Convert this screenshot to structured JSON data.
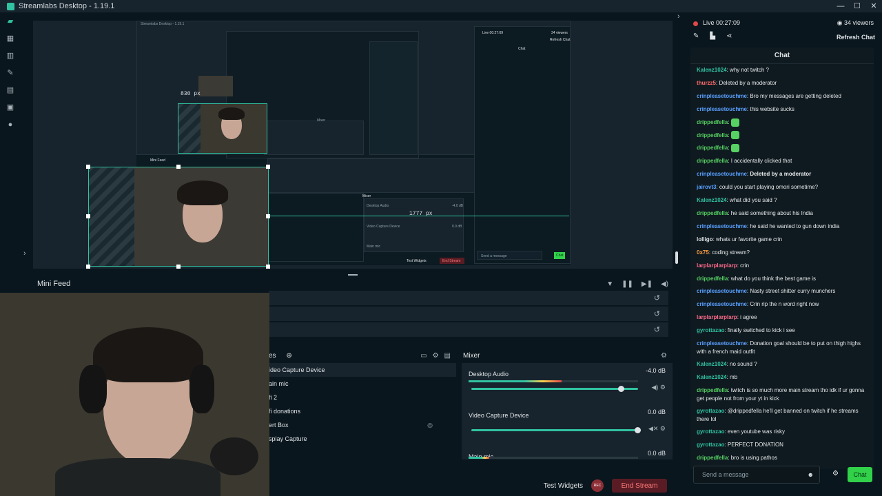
{
  "window": {
    "title": "Streamlabs Desktop - 1.19.1",
    "controls": [
      "—",
      "☐",
      "✕"
    ]
  },
  "sidebar": {
    "items": [
      {
        "icon": "editor-icon"
      },
      {
        "icon": "layout-icon"
      },
      {
        "icon": "studio-icon"
      },
      {
        "icon": "themes-icon"
      },
      {
        "icon": "app-store-icon"
      },
      {
        "icon": "highlighter-icon"
      },
      {
        "icon": "record-icon"
      }
    ]
  },
  "preview": {
    "label_width": "830 px",
    "label_offset": "1777 px",
    "inner_title": "Streamlabs Desktop - 1.19.1",
    "inner_live": "Live 00:27:09",
    "inner_viewers": "34 viewers",
    "inner_refresh": "Refresh Chat",
    "inner_chat": "Chat",
    "inner_minifeed": "Mini Feed",
    "inner_mixer": "Mixer",
    "inner_desktop": "Desktop Audio",
    "inner_desktop_db": "-4.0 dB",
    "inner_video": "Video Capture Device",
    "inner_video_db": "0.0 dB",
    "inner_mainmic": "Main mic",
    "inner_test": "Test Widgets",
    "inner_end": "End Stream",
    "inner_send": "Send a message",
    "inner_chatbtn": "Chat"
  },
  "minifeed": {
    "title": "Mini Feed"
  },
  "sources": {
    "title_fragment": "es",
    "items": [
      "ideo Capture Device",
      "ain mic",
      "fi 2",
      "fi donations",
      "ert Box",
      "splay Capture"
    ]
  },
  "mixer": {
    "title": "Mixer",
    "rows": [
      {
        "name": "Desktop Audio",
        "db": "-4.0 dB",
        "level": 0.55,
        "volume": 0.9
      },
      {
        "name": "Video Capture Device",
        "db": "0.0 dB",
        "level": 0,
        "volume": 1.0
      },
      {
        "name": "Main mic",
        "db": "0.0 dB",
        "level": 0.12,
        "volume": 1.0
      }
    ]
  },
  "footer": {
    "test_widgets": "Test Widgets",
    "rec": "REC",
    "end_stream": "End Stream"
  },
  "live": {
    "status": "Live",
    "time": "00:27:09",
    "viewers": "34 viewers",
    "refresh": "Refresh Chat"
  },
  "chat": {
    "title": "Chat",
    "input_placeholder": "Send a message",
    "send": "Chat",
    "messages": [
      {
        "user": "Kalenz1024",
        "color": "#31c3a2",
        "text": "why not twitch ?"
      },
      {
        "user": "thurzz5",
        "color": "#ff6b6b",
        "text": "Deleted by a moderator"
      },
      {
        "user": "crinpleasetouchme",
        "color": "#5aa0ff",
        "text": "Bro my messages are getting deleted"
      },
      {
        "user": "crinpleasetouchme",
        "color": "#5aa0ff",
        "text": "this website sucks"
      },
      {
        "user": "drippedfella",
        "color": "#57d163",
        "text": "",
        "emote": true
      },
      {
        "user": "drippedfella",
        "color": "#57d163",
        "text": "",
        "emote": true
      },
      {
        "user": "drippedfella",
        "color": "#57d163",
        "text": "",
        "emote": true
      },
      {
        "user": "drippedfella",
        "color": "#57d163",
        "text": "I accidentally clicked that"
      },
      {
        "user": "crinpleasetouchme",
        "color": "#5aa0ff",
        "text": "Deleted by a moderator",
        "bold": true
      },
      {
        "user": "jairovt3",
        "color": "#5aa0ff",
        "text": "could you start playing omori sometime?"
      },
      {
        "user": "Kalenz1024",
        "color": "#31c3a2",
        "text": "what did you said ?"
      },
      {
        "user": "drippedfella",
        "color": "#57d163",
        "text": "he said something about his India"
      },
      {
        "user": "crinpleasetouchme",
        "color": "#5aa0ff",
        "text": "he said he wanted to gun down india"
      },
      {
        "user": "lolligo",
        "color": "#dfe3e6",
        "text": "whats ur favorite game crin"
      },
      {
        "user": "0x75",
        "color": "#ff9f43",
        "text": "coding stream?"
      },
      {
        "user": "larplarplarplarp",
        "color": "#ff6b8b",
        "text": "crin"
      },
      {
        "user": "drippedfella",
        "color": "#57d163",
        "text": "what do you think the best game is"
      },
      {
        "user": "crinpleasetouchme",
        "color": "#5aa0ff",
        "text": "Nasty street shitter curry munchers"
      },
      {
        "user": "crinpleasetouchme",
        "color": "#5aa0ff",
        "text": "Crin rip the n word right now"
      },
      {
        "user": "larplarplarplarp",
        "color": "#ff6b8b",
        "text": "i agree"
      },
      {
        "user": "gyrottazao",
        "color": "#31c3a2",
        "text": "finally switched to kick i see"
      },
      {
        "user": "crinpleasetouchme",
        "color": "#5aa0ff",
        "text": "Donation goal should be to put on thigh highs with a french maid outfit",
        "wrap": true
      },
      {
        "user": "Kalenz1024",
        "color": "#31c3a2",
        "text": "no sound ?"
      },
      {
        "user": "Kalenz1024",
        "color": "#31c3a2",
        "text": "mb"
      },
      {
        "user": "drippedfella",
        "color": "#57d163",
        "text": "twitch is so much more main stream tho idk if ur gonna get people not from your yt in kick",
        "wrap": true
      },
      {
        "user": "gyrottazao",
        "color": "#31c3a2",
        "text": "@drippedfella he'll get banned on twitch if he streams there lol",
        "wrap": true
      },
      {
        "user": "gyrottazao",
        "color": "#31c3a2",
        "text": "even youtube was risky"
      },
      {
        "user": "gyrottazao",
        "color": "#31c3a2",
        "text": "PERFECT DONATION"
      },
      {
        "user": "drippedfella",
        "color": "#57d163",
        "text": "bro is using pathos"
      }
    ]
  },
  "colors": {
    "accent": "#31c3a2",
    "chat_button": "#31d14a",
    "end_stream": "#5a1c24",
    "live_dot": "#e04949"
  }
}
